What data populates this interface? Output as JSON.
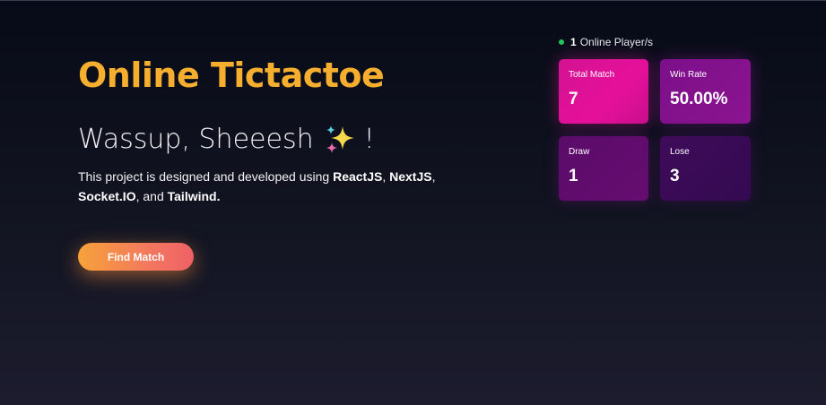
{
  "header": {
    "title": "Online Tictactoe"
  },
  "hero": {
    "greeting": "Wassup, Sheeesh",
    "greeting_suffix": "!",
    "greeting_icon": "sparkles-icon",
    "description": {
      "intro": "This project is designed and developed using ",
      "tech1": "ReactJS",
      "sep1": ", ",
      "tech2": "NextJS",
      "sep2": ", ",
      "tech3": "Socket.IO",
      "sep3": ", and ",
      "tech4": "Tailwind."
    },
    "find_match_label": "Find Match"
  },
  "online": {
    "count": "1",
    "label": "Online Player/s",
    "status_color": "#22c55e"
  },
  "stats": {
    "total_match": {
      "label": "Total Match",
      "value": "7"
    },
    "win_rate": {
      "label": "Win Rate",
      "value": "50.00%"
    },
    "draw": {
      "label": "Draw",
      "value": "1"
    },
    "lose": {
      "label": "Lose",
      "value": "3"
    }
  },
  "colors": {
    "title": "#f5ae2e",
    "button_start": "#f7a23a",
    "button_end": "#ef6066",
    "card_total": "#e6109b",
    "card_winrate": "#8c1490",
    "card_draw": "#660d70",
    "card_lose": "#3a0a55"
  }
}
